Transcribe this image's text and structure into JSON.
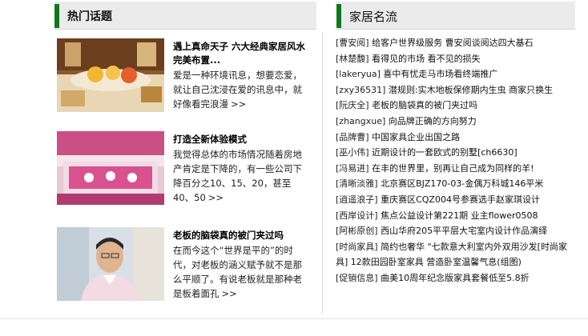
{
  "hot_topics": {
    "header": "热门话题",
    "items": [
      {
        "title": "遇上真命天子 六大经典家居风水完美布置...",
        "desc": "爱是一种环境讯息，想要恋爱，就让自己沈浸在爱的讯息中，就好像看完浪漫",
        "more": ">>"
      },
      {
        "title": "打造全新体验模式",
        "desc": "我觉得总体的市场情况随着房地产肯定是下降的，有一些公司下降百分之10、15、20，甚至40、50",
        "more": ">>"
      },
      {
        "title": "老板的脑袋真的被门夹过吗",
        "desc": "在而今这个“世界是平的”的时代，对老板的涵义赋予就不是那么平顺了。有说老板就是那种老是板着面孔",
        "more": ">>"
      }
    ]
  },
  "brands": {
    "header": "家居名流",
    "items": [
      {
        "tag": "[曹安阅]",
        "text": "给客户世界级服务 曹安阅谈阅达四大基石"
      },
      {
        "tag": "[林楚馥]",
        "text": "看得见的市场 看不见的损失"
      },
      {
        "tag": "[lakeryua]",
        "text": "喜中有忧走马市场看终端推广"
      },
      {
        "tag": "[zxy36531]",
        "text": "潜规则:实木地板保修期内生虫 商家只换生"
      },
      {
        "tag": "[阮庆全]",
        "text": "老板的脑袋真的被门夹过吗"
      },
      {
        "tag": "[zhangxue]",
        "text": "向品牌正确的方向努力"
      },
      {
        "tag": "[品牌曹]",
        "text": "中国家具企业出国之路"
      },
      {
        "tag": "[巫小伟]",
        "text": "近期设计的一套欧式的别墅[ch6630]"
      },
      {
        "tag": "[冯易进]",
        "text": "在丰的世界里，别再让自己成为同样的羊!"
      },
      {
        "tag": "[清晰淡雅]",
        "text": "北京赛区BJZ170-03-金偶万科城146平米"
      },
      {
        "tag": "[逍遥浪子]",
        "text": "重庆赛区CQZ004号参赛选手赵家琪设计"
      },
      {
        "tag": "[西岸设计]",
        "text": "焦点公益设计第221期 业主flower0508"
      },
      {
        "tag": "[阿彬原创]",
        "text": "西山华府205平平层大宅室内设计作品演绎"
      },
      {
        "tag": "[时尚家具]",
        "text": "简约也奢华 \"七款意大利室内外双用沙发[时尚家具] 12款田园卧室家具 营造卧室温馨气息(组图)"
      },
      {
        "tag": "[促销信息]",
        "text": "曲美10周年纪念版家具套餐低至5.8折"
      }
    ]
  },
  "colors": {
    "accent": "#0b7a1d",
    "header_bg": "#ebebeb"
  }
}
